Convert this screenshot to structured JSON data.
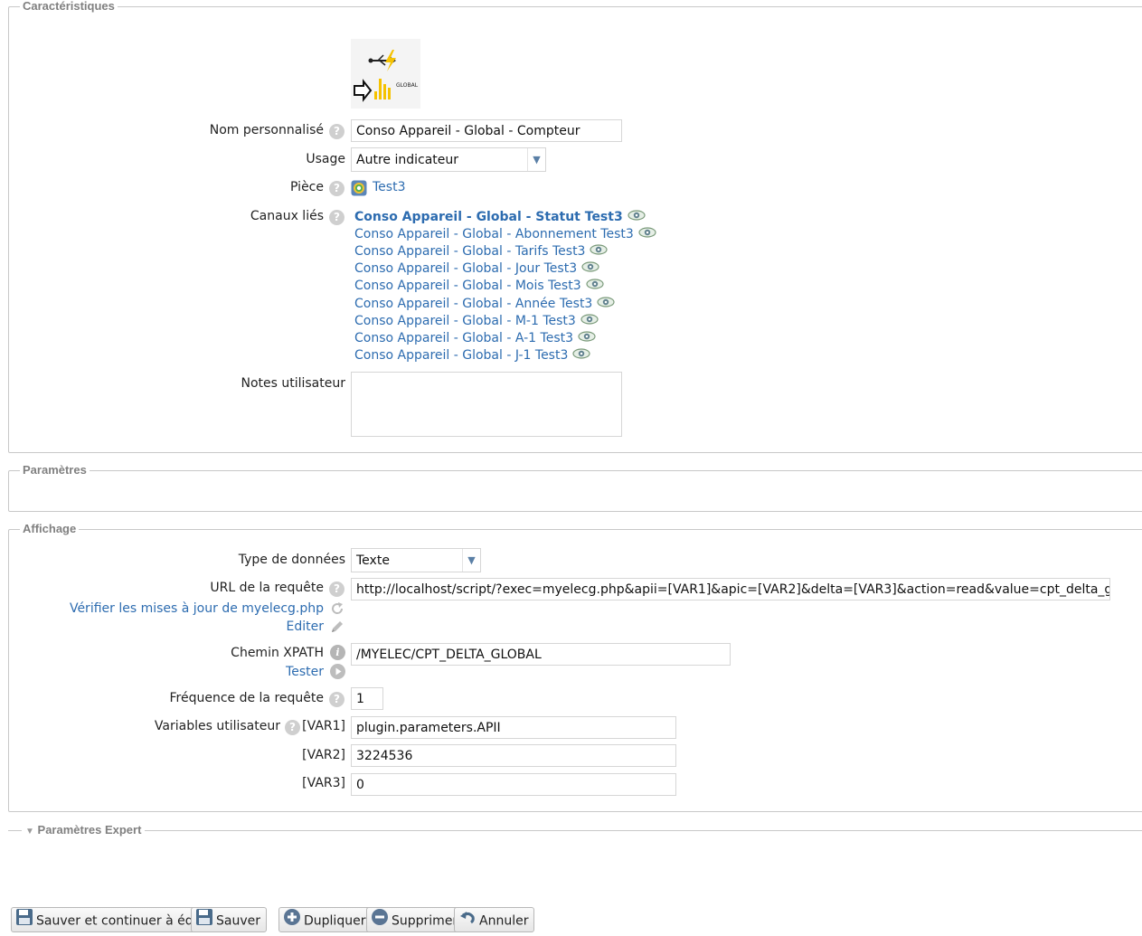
{
  "caracteristiques": {
    "legend": "Caractéristiques",
    "icon_text": "GLOBAL",
    "nom_label": "Nom personnalisé",
    "nom_value": "Conso Appareil - Global - Compteur",
    "usage_label": "Usage",
    "usage_value": "Autre indicateur",
    "piece_label": "Pièce",
    "piece_value": "Test3",
    "canaux_label": "Canaux liés",
    "canaux": [
      "Conso Appareil - Global - Statut Test3",
      "Conso Appareil - Global - Abonnement Test3",
      "Conso Appareil - Global - Tarifs Test3",
      "Conso Appareil - Global - Jour Test3",
      "Conso Appareil - Global - Mois Test3",
      "Conso Appareil - Global - Année Test3",
      "Conso Appareil - Global - M-1 Test3",
      "Conso Appareil - Global - A-1 Test3",
      "Conso Appareil - Global - J-1 Test3"
    ],
    "notes_label": "Notes utilisateur",
    "notes_value": ""
  },
  "parametres": {
    "legend": "Paramètres"
  },
  "affichage": {
    "legend": "Affichage",
    "type_label": "Type de données",
    "type_value": "Texte",
    "url_label": "URL de la requête",
    "url_value": "http://localhost/script/?exec=myelecg.php&apii=[VAR1]&apic=[VAR2]&delta=[VAR3]&action=read&value=cpt_delta_global",
    "verifier_link": "Vérifier les mises à jour de myelecg.php",
    "editer_link": "Editer",
    "xpath_label": "Chemin XPATH",
    "xpath_value": "/MYELEC/CPT_DELTA_GLOBAL",
    "tester_link": "Tester",
    "freq_label": "Fréquence de la requête",
    "freq_value": "1",
    "vars_label": "Variables utilisateur",
    "var1_label": "[VAR1]",
    "var1_value": "plugin.parameters.APII",
    "var2_label": "[VAR2]",
    "var2_value": "3224536",
    "var3_label": "[VAR3]",
    "var3_value": "0"
  },
  "expert": {
    "legend": "Paramètres Expert"
  },
  "buttons": {
    "save_continue": "Sauver et continuer à éditer",
    "save": "Sauver",
    "duplicate": "Dupliquer",
    "delete": "Supprimer",
    "cancel": "Annuler"
  },
  "colors": {
    "link": "#2d6cb0",
    "legend": "#808080",
    "border": "#c8c8c8"
  },
  "icons": [
    "help-icon",
    "eye-icon",
    "room-icon",
    "refresh-icon",
    "pencil-icon",
    "info-icon",
    "play-icon",
    "save-icon",
    "add-icon",
    "delete-icon",
    "undo-icon"
  ]
}
